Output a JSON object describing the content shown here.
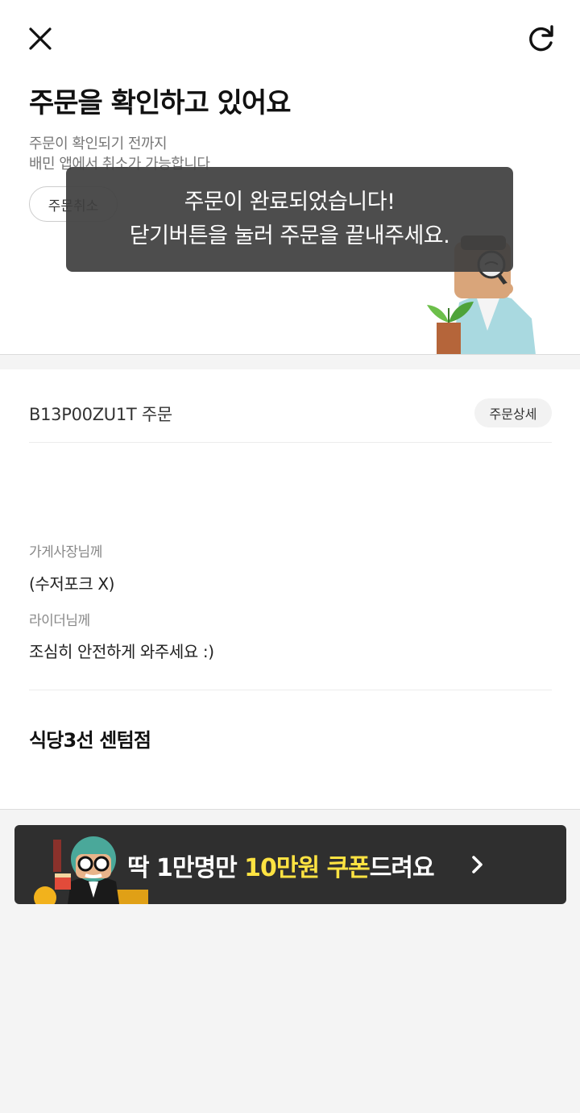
{
  "header": {
    "close_icon": "close-icon",
    "refresh_icon": "refresh-icon",
    "title": "주문을 확인하고 있어요",
    "subtitle_line1": "주문이 확인되기 전까지",
    "subtitle_line2": "배민 앱에서 취소가 가능합니다",
    "cancel_label": "주문취소"
  },
  "toast": {
    "line1": "주문이 완료되었습니다!",
    "line2": "닫기버튼을 눌러 주문을 끝내주세요."
  },
  "order": {
    "number_text": "B13P00ZU1T 주문",
    "detail_label": "주문상세",
    "owner_label": "가게사장님께",
    "owner_message": "(수저포크 X)",
    "rider_label": "라이더님께",
    "rider_message": "조심히 안전하게 와주세요 :)",
    "store_name": "식당3선 센텀점"
  },
  "banner": {
    "text_pre": "딱 1만명만 ",
    "text_hl": "10만원 쿠폰",
    "text_post": "드려요",
    "highlight_color": "#ffe342",
    "arrow_icon": "chevron-right-icon"
  }
}
